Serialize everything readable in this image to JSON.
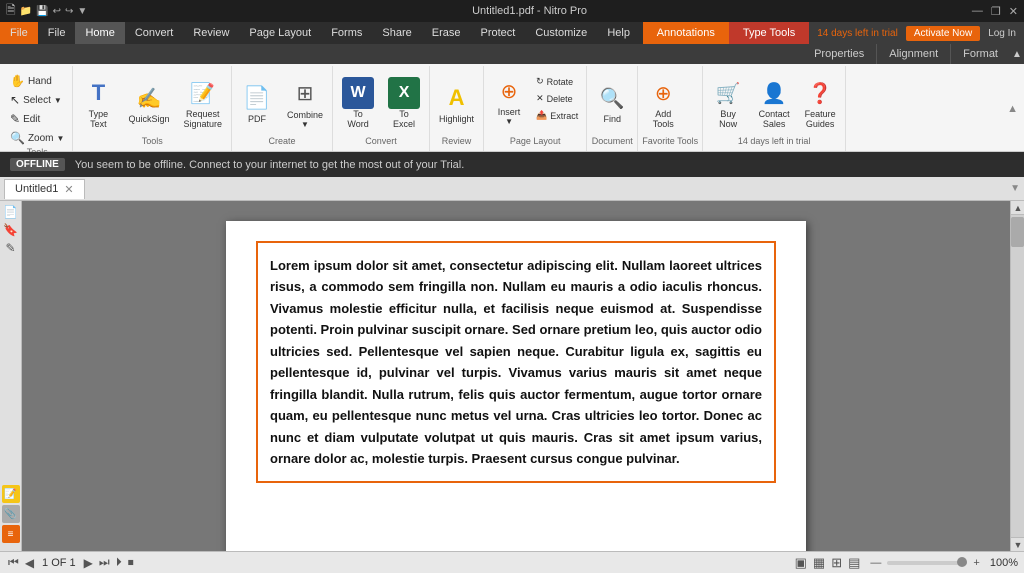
{
  "window": {
    "title": "Untitled1.pdf - Nitro Pro",
    "controls": [
      "—",
      "❐",
      "✕"
    ]
  },
  "titlebar": {
    "icons": [
      "🗎",
      "📁",
      "💾",
      "↩",
      "↪",
      "▼"
    ],
    "title": "Untitled1.pdf - Nitro Pro"
  },
  "menubar": {
    "items": [
      "File",
      "Home",
      "Convert",
      "Review",
      "Page Layout",
      "Forms",
      "Share",
      "Erase",
      "Protect",
      "Customize",
      "Help"
    ]
  },
  "ribbon_tabs": {
    "right_section_label_annot": "Annotations",
    "right_section_label_type": "Type Tools",
    "tabs_right": [
      "Properties",
      "Alignment",
      "Format"
    ]
  },
  "trial_bar": {
    "days_left": "14 days left in trial",
    "activate_btn": "Activate Now",
    "login_btn": "Log In"
  },
  "ribbon": {
    "groups": [
      {
        "name": "tools",
        "label": "Tools",
        "buttons": [
          {
            "id": "hand",
            "label": "Hand",
            "icon": "✋"
          },
          {
            "id": "select",
            "label": "Select",
            "icon": "↖",
            "has_arrow": true
          },
          {
            "id": "edit",
            "label": "Edit",
            "icon": "✎"
          },
          {
            "id": "zoom",
            "label": "Zoom",
            "icon": "🔍",
            "has_arrow": true
          }
        ]
      },
      {
        "name": "tools2",
        "label": "Tools",
        "buttons": [
          {
            "id": "type",
            "label": "Type\nText",
            "icon": "T"
          },
          {
            "id": "quicksign",
            "label": "QuickSign",
            "icon": "✍"
          },
          {
            "id": "request",
            "label": "Request\nSignature",
            "icon": "📝"
          }
        ]
      },
      {
        "name": "create",
        "label": "Create",
        "buttons": [
          {
            "id": "pdf",
            "label": "PDF",
            "icon": "📄"
          },
          {
            "id": "combine",
            "label": "Combine",
            "icon": "⊞",
            "has_arrow": true
          }
        ]
      },
      {
        "name": "convert",
        "label": "Convert",
        "buttons": [
          {
            "id": "to-word",
            "label": "To\nWord",
            "icon": "W"
          },
          {
            "id": "to-excel",
            "label": "To\nExcel",
            "icon": "X"
          }
        ]
      },
      {
        "name": "review",
        "label": "Review",
        "buttons": [
          {
            "id": "highlight",
            "label": "Highlight",
            "icon": "A"
          }
        ]
      },
      {
        "name": "page-layout",
        "label": "Page Layout",
        "buttons": [
          {
            "id": "insert",
            "label": "Insert",
            "icon": "⊕",
            "has_arrow": true
          },
          {
            "id": "rotate",
            "label": "Rotate",
            "icon": "↻"
          },
          {
            "id": "delete",
            "label": "Delete",
            "icon": "✕"
          },
          {
            "id": "extract",
            "label": "Extract",
            "icon": "📤"
          }
        ]
      },
      {
        "name": "document",
        "label": "Document",
        "buttons": [
          {
            "id": "find",
            "label": "Find",
            "icon": "🔍"
          }
        ]
      },
      {
        "name": "favorite-tools",
        "label": "Favorite Tools",
        "buttons": [
          {
            "id": "add-tools",
            "label": "Add\nTools",
            "icon": "⊕"
          }
        ]
      },
      {
        "name": "days-trial",
        "label": "14 days left in trial",
        "buttons": [
          {
            "id": "buy-now",
            "label": "Buy\nNow",
            "icon": "🛒"
          },
          {
            "id": "contact-sales",
            "label": "Contact\nSales",
            "icon": "👤"
          },
          {
            "id": "feature-guides",
            "label": "Feature\nGuides",
            "icon": "❓"
          }
        ]
      }
    ]
  },
  "offline_bar": {
    "badge": "OFFLINE",
    "message": "You seem to be offline. Connect to your internet to get the most out of your Trial."
  },
  "doc_tabs": {
    "tabs": [
      {
        "label": "Untitled1",
        "active": true
      }
    ]
  },
  "document": {
    "content": "Lorem ipsum dolor sit amet, consectetur adipiscing elit. Nullam laoreet ultrices risus, a commodo sem fringilla non. Nullam eu mauris a odio iaculis rhoncus. Vivamus molestie efficitur nulla, et facilisis neque euismod at. Suspendisse potenti. Proin pulvinar suscipit ornare. Sed ornare pretium leo, quis auctor odio ultricies sed. Pellentesque vel sapien neque. Curabitur ligula ex, sagittis eu pellentesque id, pulvinar vel turpis. Vivamus varius mauris sit amet neque fringilla blandit. Nulla rutrum, felis quis auctor fermentum, augue tortor ornare quam, eu pellentesque nunc metus vel urna. Cras ultricies leo tortor. Donec ac nunc et diam vulputate volutpat ut quis mauris. Cras sit amet ipsum varius, ornare dolor ac, molestie turpis. Praesent cursus congue pulvinar."
  },
  "status_bar": {
    "nav_buttons": [
      "⏮",
      "◀",
      "",
      "▶",
      "⏭"
    ],
    "page_info": "1 OF 1",
    "play_btn": "⏵",
    "stop_btn": "⏹",
    "view_icons": [
      "▣",
      "▦",
      "⊞",
      "▤"
    ],
    "zoom_out": "—",
    "zoom_in": "+",
    "zoom_level": "100%"
  },
  "left_sidebar": {
    "icons": [
      "📄",
      "🔖",
      "✎",
      "📎"
    ]
  }
}
